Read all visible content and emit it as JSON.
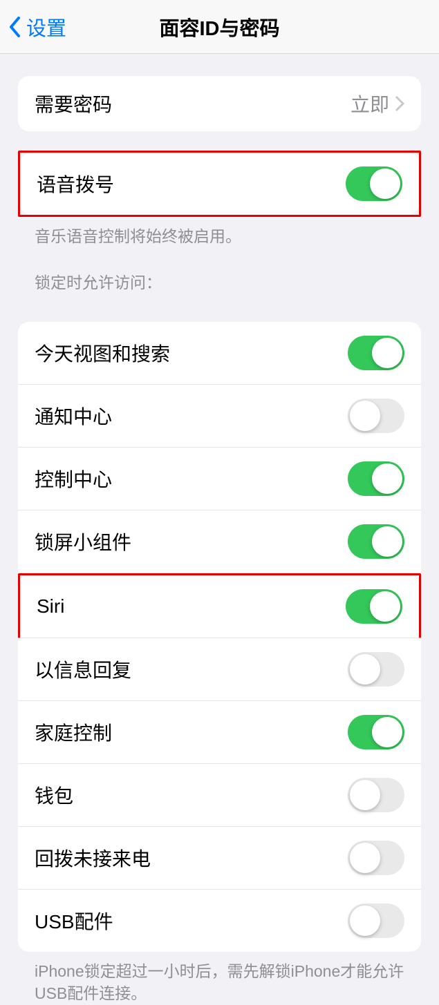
{
  "header": {
    "back_label": "设置",
    "title": "面容ID与密码"
  },
  "require_passcode": {
    "label": "需要密码",
    "value": "立即"
  },
  "voice_dial": {
    "label": "语音拨号",
    "enabled": true,
    "footer": "音乐语音控制将始终被启用。"
  },
  "lock_access": {
    "header": "锁定时允许访问：",
    "items": [
      {
        "label": "今天视图和搜索",
        "enabled": true
      },
      {
        "label": "通知中心",
        "enabled": false
      },
      {
        "label": "控制中心",
        "enabled": true
      },
      {
        "label": "锁屏小组件",
        "enabled": true
      },
      {
        "label": "Siri",
        "enabled": true
      },
      {
        "label": "以信息回复",
        "enabled": false
      },
      {
        "label": "家庭控制",
        "enabled": true
      },
      {
        "label": "钱包",
        "enabled": false
      },
      {
        "label": "回拨未接来电",
        "enabled": false
      },
      {
        "label": "USB配件",
        "enabled": false
      }
    ],
    "footer": "iPhone锁定超过一小时后，需先解锁iPhone才能允许USB配件连接。"
  }
}
